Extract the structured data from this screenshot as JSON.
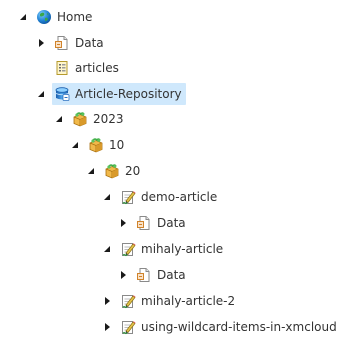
{
  "tree": {
    "home": {
      "label": "Home",
      "icon": "globe-icon",
      "state": "expanded"
    },
    "data_1": {
      "label": "Data",
      "icon": "template-page-icon",
      "state": "collapsed"
    },
    "articles": {
      "label": "articles",
      "icon": "document-list-icon",
      "state": "leaf"
    },
    "article_repository": {
      "label": "Article-Repository",
      "icon": "database-icon",
      "state": "expanded",
      "selected": true
    },
    "year_2023": {
      "label": "2023",
      "icon": "folder-box-icon",
      "state": "expanded"
    },
    "month_10": {
      "label": "10",
      "icon": "folder-box-icon",
      "state": "expanded"
    },
    "day_20": {
      "label": "20",
      "icon": "folder-box-icon",
      "state": "expanded"
    },
    "demo_article": {
      "label": "demo-article",
      "icon": "article-edit-icon",
      "state": "expanded"
    },
    "data_2": {
      "label": "Data",
      "icon": "template-page-icon",
      "state": "collapsed"
    },
    "mihaly_article": {
      "label": "mihaly-article",
      "icon": "article-edit-icon",
      "state": "expanded"
    },
    "data_3": {
      "label": "Data",
      "icon": "template-page-icon",
      "state": "collapsed"
    },
    "mihaly_article_2": {
      "label": "mihaly-article-2",
      "icon": "article-edit-icon",
      "state": "collapsed"
    },
    "wildcard_article": {
      "label": "using-wildcard-items-in-xmcloud",
      "icon": "article-edit-icon",
      "state": "collapsed"
    }
  },
  "colors": {
    "selection": "#cfe8fc",
    "text": "#333333",
    "toggle": "#1a1a1a"
  }
}
